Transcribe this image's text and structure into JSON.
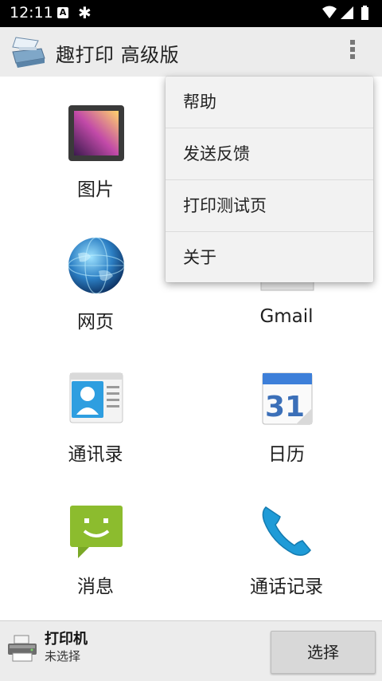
{
  "status_bar": {
    "time": "12:11",
    "icons": [
      "a-notification-icon",
      "bug-icon",
      "wifi-icon",
      "signal-icon",
      "battery-icon"
    ]
  },
  "action_bar": {
    "title": "趣打印 高级版",
    "overflow_icon": "overflow-menu-icon"
  },
  "grid": {
    "items": [
      {
        "label": "图片",
        "icon": "pictures-icon"
      },
      {
        "label": "Gmail",
        "icon": "gmail-icon"
      },
      {
        "label": "网页",
        "icon": "web-globe-icon"
      },
      {
        "label": "通讯录",
        "icon": "contacts-icon"
      },
      {
        "label": "日历",
        "icon": "calendar-icon",
        "icon_text": "31"
      },
      {
        "label": "消息",
        "icon": "messages-icon"
      },
      {
        "label": "通话记录",
        "icon": "call-log-icon"
      }
    ]
  },
  "menu": {
    "items": [
      "帮助",
      "发送反馈",
      "打印测试页",
      "关于"
    ]
  },
  "bottom_bar": {
    "title": "打印机",
    "subtitle": "未选择",
    "button_label": "选择"
  },
  "colors": {
    "action_bar_bg": "#ececec",
    "status_bar_bg": "#000000",
    "menu_bg": "#f2f2f2",
    "button_bg": "#d8d8d8"
  }
}
